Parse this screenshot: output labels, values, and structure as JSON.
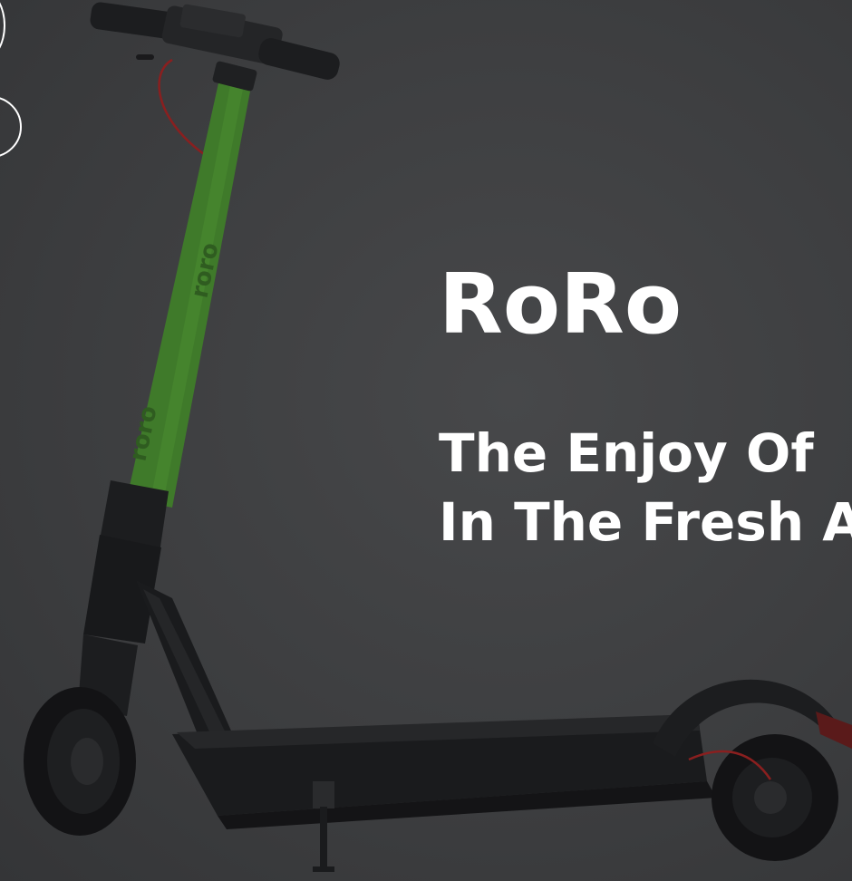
{
  "hero": {
    "title": "RoRo",
    "tagline_line1": "The Enjoy Of",
    "tagline_line2": "In The Fresh A",
    "deck_logo_1": "roro",
    "deck_logo_2": "roro"
  },
  "colors": {
    "background": "#3d3e40",
    "stem_green": "#3f7a2a",
    "scooter_black": "#1c1d1f",
    "text": "#ffffff"
  },
  "icons": {
    "nav_indicator": "circle-outline-icon"
  }
}
